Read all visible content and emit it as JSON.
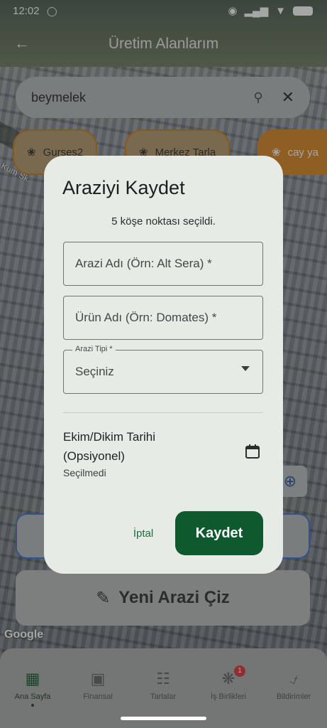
{
  "status": {
    "time": "12:02"
  },
  "header": {
    "title": "Üretim Alanlarım"
  },
  "search": {
    "value": "beymelek"
  },
  "chips": [
    "Gurses2",
    "Merkez Tarla",
    "cay ya"
  ],
  "map": {
    "street_label": "Kum Sk.",
    "attribution": "Google"
  },
  "new_area_button": {
    "label": "Yeni Arazi Çiz"
  },
  "dialog": {
    "title": "Araziyi Kaydet",
    "subtitle": "5 köşe noktası seçildi.",
    "area_name_placeholder": "Arazi Adı (Örn: Alt Sera) *",
    "product_name_placeholder": "Ürün Adı (Örn: Domates) *",
    "area_type_label": "Arazi Tipi *",
    "area_type_value": "Seçiniz",
    "date_label": "Ekim/Dikim Tarihi (Opsiyonel)",
    "date_value": "Seçilmedi",
    "cancel_label": "İptal",
    "save_label": "Kaydet"
  },
  "bottom_nav": [
    {
      "label": "Ana Sayfa",
      "icon": "grid-icon",
      "active": true
    },
    {
      "label": "Finansal",
      "icon": "wallet-icon"
    },
    {
      "label": "Tarlalar",
      "icon": "map-icon"
    },
    {
      "label": "İş Birlikleri",
      "icon": "network-icon",
      "badge": "1"
    },
    {
      "label": "Bildirimler",
      "icon": "bell-icon"
    }
  ],
  "colors": {
    "primary": "#0e5a2e",
    "chip_accent": "#d7841e",
    "dialog_bg": "#e7ebe5"
  }
}
